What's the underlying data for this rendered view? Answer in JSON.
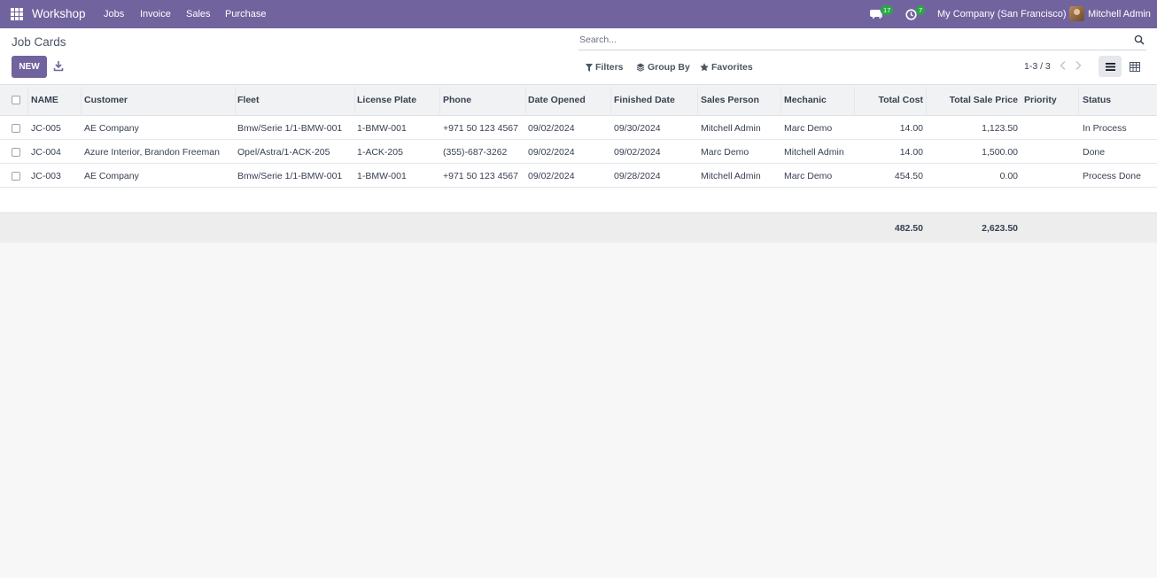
{
  "navbar": {
    "app_name": "Workshop",
    "menu": [
      "Jobs",
      "Invoice",
      "Sales",
      "Purchase"
    ],
    "messages_count": "17",
    "activities_count": "7",
    "company": "My Company (San Francisco)",
    "user": "Mitchell Admin",
    "accent_color": "#71639e"
  },
  "control": {
    "title": "Job Cards",
    "new_label": "NEW",
    "search_placeholder": "Search...",
    "filters_label": "Filters",
    "group_by_label": "Group By",
    "favorites_label": "Favorites",
    "pager": "1-3 / 3"
  },
  "table": {
    "columns": [
      "NAME",
      "Customer",
      "Fleet",
      "License Plate",
      "Phone",
      "Date Opened",
      "Finished Date",
      "Sales Person",
      "Mechanic",
      "Total Cost",
      "Total Sale Price",
      "Priority",
      "Status"
    ],
    "rows": [
      [
        "JC-005",
        "AE Company",
        "Bmw/Serie 1/1-BMW-001",
        "1-BMW-001",
        "+971 50 123 4567",
        "09/02/2024",
        "09/30/2024",
        "Mitchell Admin",
        "Marc Demo",
        "14.00",
        "1,123.50",
        "",
        "In Process"
      ],
      [
        "JC-004",
        "Azure Interior, Brandon Freeman",
        "Opel/Astra/1-ACK-205",
        "1-ACK-205",
        "(355)-687-3262",
        "09/02/2024",
        "09/02/2024",
        "Marc Demo",
        "Mitchell Admin",
        "14.00",
        "1,500.00",
        "",
        "Done"
      ],
      [
        "JC-003",
        "AE Company",
        "Bmw/Serie 1/1-BMW-001",
        "1-BMW-001",
        "+971 50 123 4567",
        "09/02/2024",
        "09/28/2024",
        "Mitchell Admin",
        "Marc Demo",
        "454.50",
        "0.00",
        "",
        "Process Done"
      ]
    ],
    "totals": {
      "total_cost": "482.50",
      "total_sale_price": "2,623.50"
    }
  }
}
